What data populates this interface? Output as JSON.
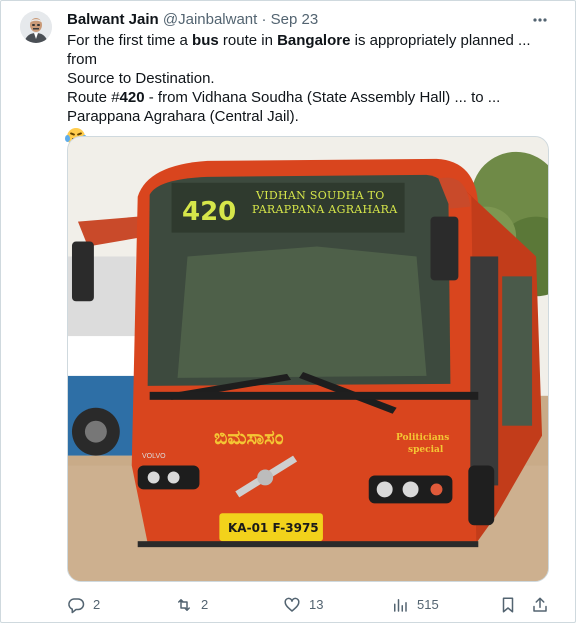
{
  "author": {
    "name": "Balwant Jain",
    "handle": "@Jainbalwant",
    "separator": "·",
    "date": "Sep 23"
  },
  "tweet": {
    "line1_part1": "For the first time a ",
    "line1_bold1": "bus",
    "line1_part2": " route in ",
    "line1_bold2": "Bangalore",
    "line1_part3": " is appropriately planned ... from",
    "line2": "Source to Destination.",
    "line3_part1": "Route #",
    "line3_bold": "420",
    "line3_part2": " - from Vidhana Soudha (State Assembly Hall) ... to ...",
    "line4": "Parappana Agrahara (Central Jail).",
    "emoji": "face-with-tears-of-joy"
  },
  "media": {
    "route_number": "420",
    "destination_line1": "VIDHAN SOUDHA TO",
    "destination_line2": "PARAPPANA AGRAHARA",
    "bus_name": "ಬಿಮಸಾಸಂ",
    "side_text_line1": "Politicians",
    "side_text_line2": "special",
    "plate": "KA-01 F-3975",
    "brand": "VOLVO"
  },
  "actions": {
    "replies": "2",
    "retweets": "2",
    "likes": "13",
    "views": "515"
  },
  "colors": {
    "text": "#0f1419",
    "muted": "#536471",
    "border": "#cfd9de",
    "bus_red": "#d9451e",
    "sign_yellow": "#d6e64a"
  }
}
